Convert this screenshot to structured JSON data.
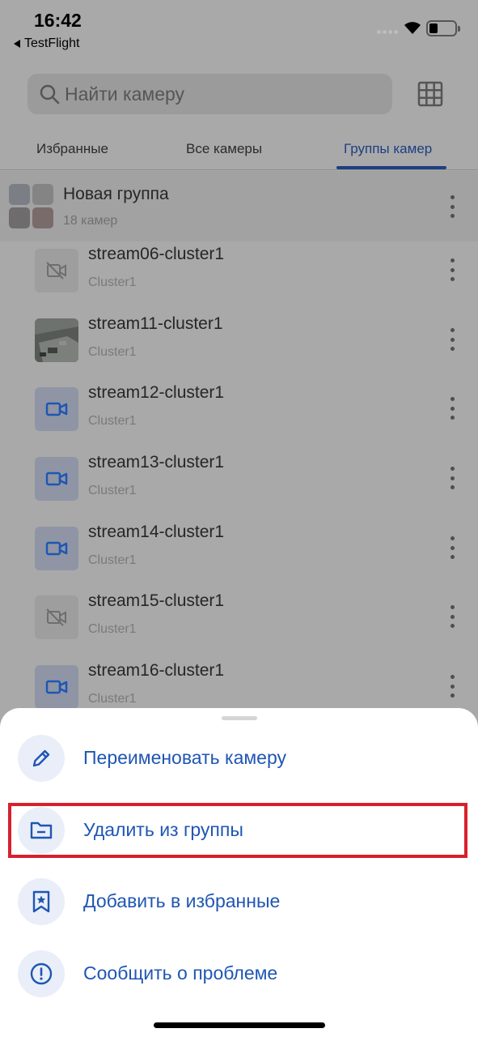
{
  "status_bar": {
    "time": "16:42",
    "back_app": "TestFlight"
  },
  "search": {
    "placeholder": "Найти камеру",
    "icon": "search-icon",
    "grid_icon": "grid-view-icon"
  },
  "tabs": [
    {
      "label": "Избранные",
      "active": false
    },
    {
      "label": "Все камеры",
      "active": false
    },
    {
      "label": "Группы камер",
      "active": true
    }
  ],
  "group": {
    "title": "Новая группа",
    "count": "18 камер"
  },
  "cameras": [
    {
      "name": "stream06-cluster1",
      "cluster": "Cluster1",
      "state": "offline"
    },
    {
      "name": "stream11-cluster1",
      "cluster": "Cluster1",
      "state": "preview"
    },
    {
      "name": "stream12-cluster1",
      "cluster": "Cluster1",
      "state": "online"
    },
    {
      "name": "stream13-cluster1",
      "cluster": "Cluster1",
      "state": "online"
    },
    {
      "name": "stream14-cluster1",
      "cluster": "Cluster1",
      "state": "online"
    },
    {
      "name": "stream15-cluster1",
      "cluster": "Cluster1",
      "state": "offline"
    },
    {
      "name": "stream16-cluster1",
      "cluster": "Cluster1",
      "state": "online"
    }
  ],
  "sheet": {
    "actions": [
      {
        "label": "Переименовать камеру",
        "icon": "pencil-icon"
      },
      {
        "label": "Удалить из группы",
        "icon": "folder-minus-icon"
      },
      {
        "label": "Добавить в избранные",
        "icon": "bookmark-star-icon"
      },
      {
        "label": "Сообщить о проблеме",
        "icon": "alert-circle-icon"
      }
    ]
  },
  "colors": {
    "accent": "#1f56b4",
    "highlight": "#d8202c"
  }
}
